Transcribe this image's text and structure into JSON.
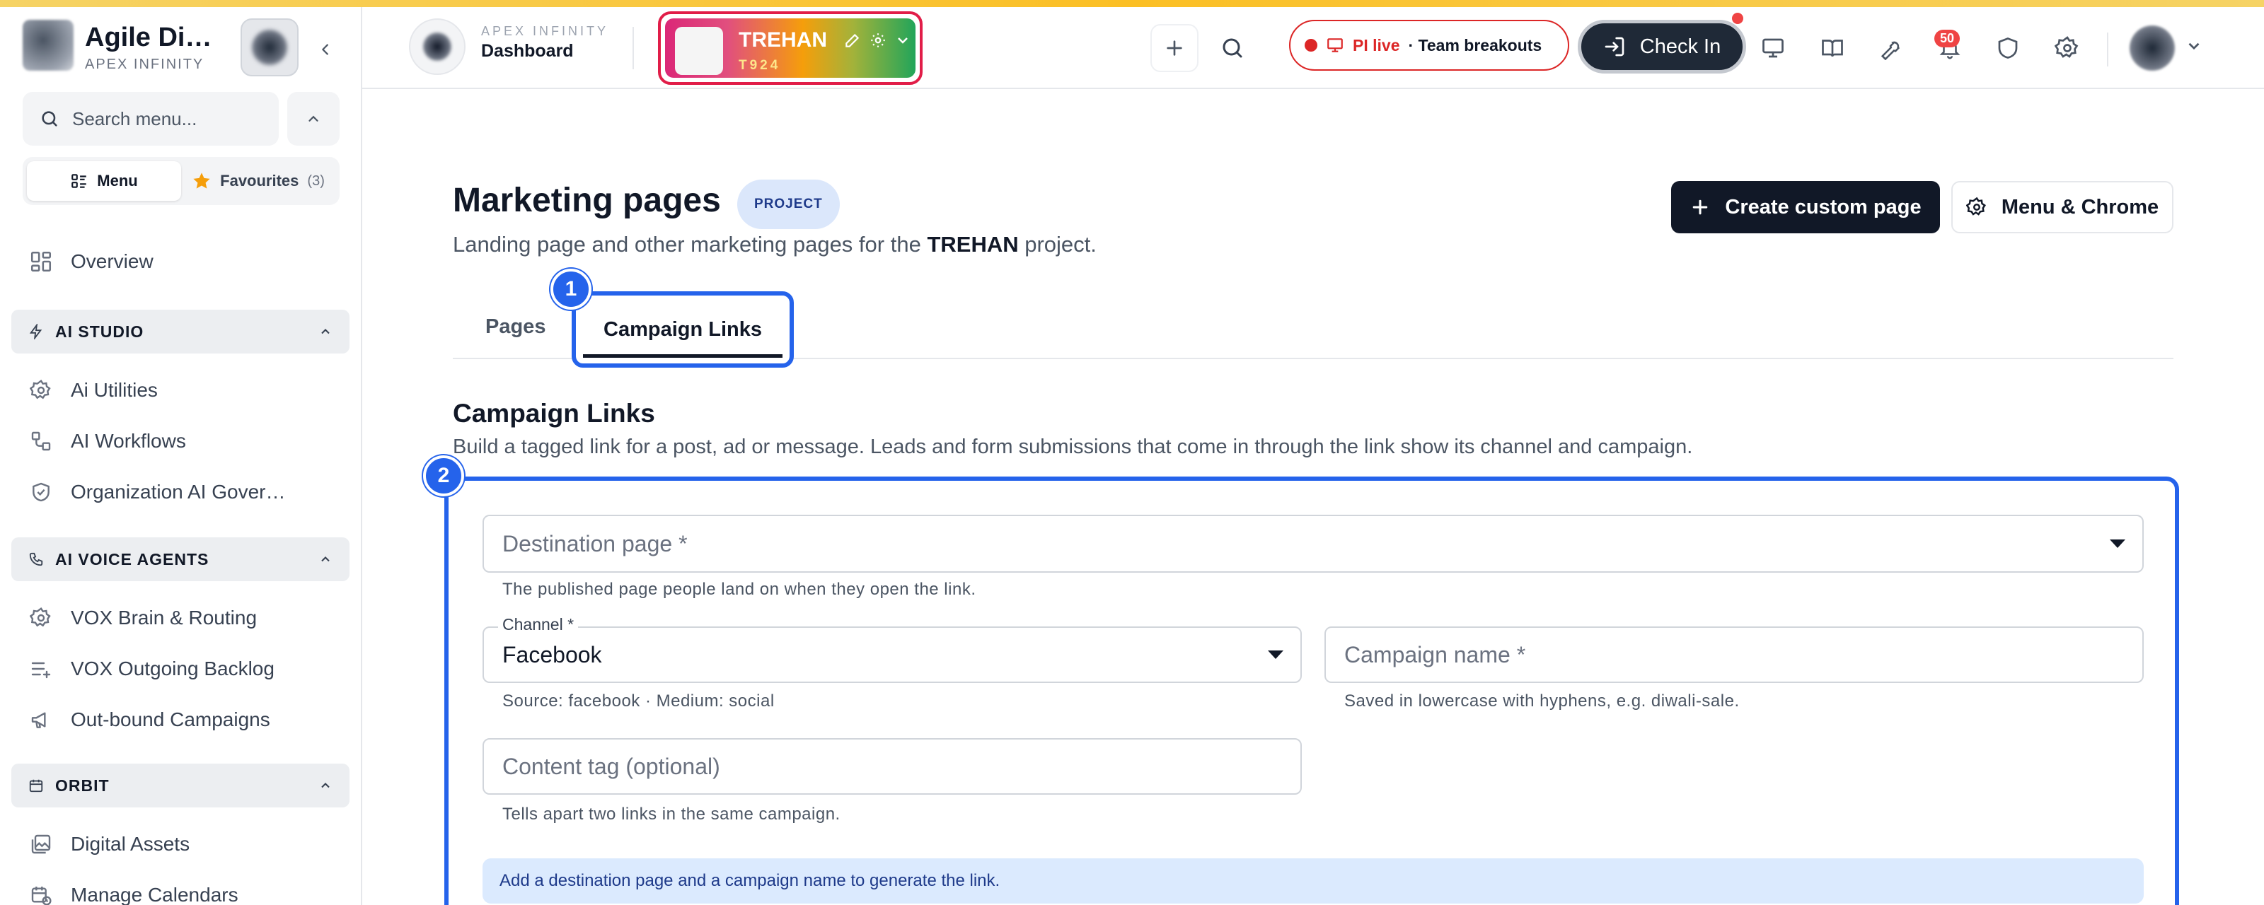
{
  "sidebar": {
    "brand_name": "Agile Di…",
    "brand_sub": "APEX INFINITY",
    "search_placeholder": "Search menu...",
    "tab_menu": "Menu",
    "tab_favourites": "Favourites",
    "favourites_count": "(3)",
    "overview": "Overview",
    "sections": [
      {
        "title": "AI STUDIO",
        "items": [
          "Ai Utilities",
          "AI Workflows",
          "Organization AI Gover…"
        ]
      },
      {
        "title": "AI VOICE AGENTS",
        "items": [
          "VOX Brain & Routing",
          "VOX Outgoing Backlog",
          "Out-bound Campaigns"
        ]
      },
      {
        "title": "ORBIT",
        "items": [
          "Digital Assets",
          "Manage Calendars"
        ]
      }
    ]
  },
  "topbar": {
    "org_label": "APEX INFINITY",
    "page_label": "Dashboard",
    "project_name": "TREHAN",
    "project_code": "T924",
    "pi_live_label": "PI live",
    "pi_live_detail": "· Team breakouts",
    "checkin_label": "Check In",
    "notification_count": "50"
  },
  "main": {
    "title": "Marketing pages",
    "badge": "PROJECT",
    "subtitle_prefix": "Landing page and other marketing pages for the",
    "subtitle_project": "TREHAN",
    "subtitle_suffix": "project.",
    "create_button": "Create custom page",
    "menu_chrome_button": "Menu & Chrome",
    "tabs": [
      {
        "label": "Pages"
      },
      {
        "label": "Campaign Links"
      }
    ],
    "step_badges": [
      "1",
      "2"
    ],
    "section_title": "Campaign Links",
    "section_desc": "Build a tagged link for a post, ad or message. Leads and form submissions that come in through the link show its channel and campaign.",
    "form": {
      "destination_placeholder": "Destination page *",
      "destination_help": "The published page people land on when they open the link.",
      "channel_label": "Channel *",
      "channel_value": "Facebook",
      "channel_help": "Source: facebook · Medium: social",
      "campaign_placeholder": "Campaign name *",
      "campaign_help": "Saved in lowercase with hyphens, e.g. diwali-sale.",
      "content_placeholder": "Content tag (optional)",
      "content_help": "Tells apart two links in the same campaign.",
      "info": "Add a destination page and a campaign name to generate the link."
    }
  },
  "colors": {
    "accent": "#2563eb",
    "primary_dark": "#111827",
    "live_red": "#dc2626"
  }
}
